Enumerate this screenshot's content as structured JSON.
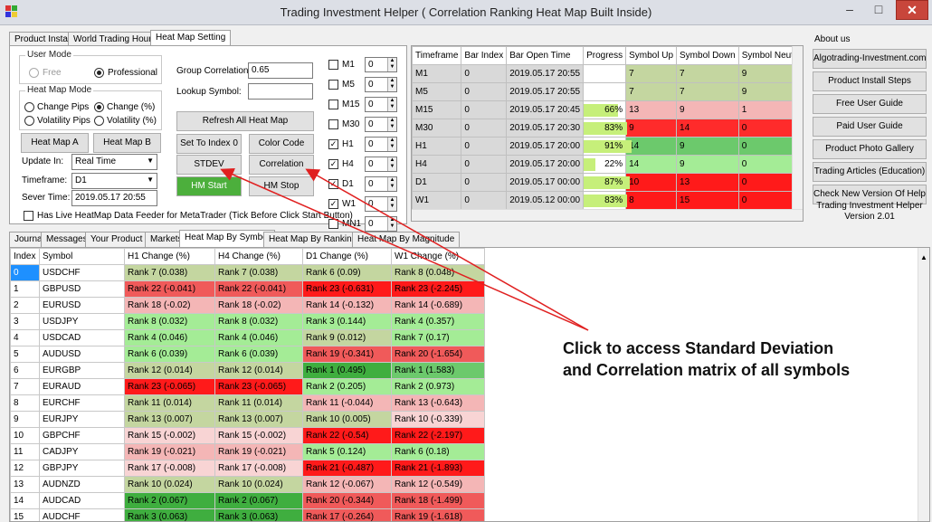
{
  "window": {
    "title": "Trading Investment Helper ( Correlation Ranking Heat Map Built Inside)",
    "minimize": "–",
    "maximize": "□",
    "close": "✕"
  },
  "top_tabs": [
    "Product Install",
    "World Trading Hours",
    "Heat Map Setting"
  ],
  "user_mode": {
    "title": "User Mode",
    "free": "Free",
    "professional": "Professional"
  },
  "heat_map_mode": {
    "title": "Heat Map Mode",
    "change_pips": "Change Pips",
    "change_pct": "Change (%)",
    "volatility_pips": "Volatility Pips",
    "volatility_pct": "Volatility (%)"
  },
  "buttons": {
    "heat_map_a": "Heat Map A",
    "heat_map_b": "Heat Map B",
    "refresh": "Refresh All Heat Map",
    "set_index": "Set To Index 0",
    "color_code": "Color Code",
    "stdev": "STDEV",
    "correlation": "Correlation",
    "hm_start": "HM Start",
    "hm_stop": "HM Stop"
  },
  "fields": {
    "update_in_label": "Update In:",
    "update_in_value": "Real Time",
    "timeframe_label": "Timeframe:",
    "timeframe_value": "D1",
    "server_time_label": "Sever Time:",
    "server_time_value": "2019.05.17 20:55",
    "group_corr_label": "Group Correlation:",
    "group_corr_value": "0.65",
    "lookup_label": "Lookup Symbol:",
    "lookup_value": ""
  },
  "live_feeder": "Has Live HeatMap Data Feeder for MetaTrader (Tick Before Click Start Button)",
  "tf_checks": [
    {
      "label": "M1",
      "value": "0",
      "checked": false
    },
    {
      "label": "M5",
      "value": "0",
      "checked": false
    },
    {
      "label": "M15",
      "value": "0",
      "checked": false
    },
    {
      "label": "M30",
      "value": "0",
      "checked": false
    },
    {
      "label": "H1",
      "value": "0",
      "checked": true
    },
    {
      "label": "H4",
      "value": "0",
      "checked": true
    },
    {
      "label": "D1",
      "value": "0",
      "checked": true
    },
    {
      "label": "W1",
      "value": "0",
      "checked": true
    },
    {
      "label": "MN1",
      "value": "0",
      "checked": false
    }
  ],
  "tf_table": {
    "headers": [
      "Timeframe",
      "Bar Index",
      "Bar Open Time",
      "Progress",
      "Symbol Up",
      "Symbol Down",
      "Symbol Neutral"
    ],
    "rows": [
      {
        "tf": "M1",
        "idx": "0",
        "time": "2019.05.17 20:55",
        "progress": "",
        "pct": 0,
        "up": "7",
        "down": "7",
        "neu": "9",
        "c": [
          "#c4d6a0",
          "#c4d6a0",
          "#c4d6a0"
        ]
      },
      {
        "tf": "M5",
        "idx": "0",
        "time": "2019.05.17 20:55",
        "progress": "",
        "pct": 0,
        "up": "7",
        "down": "7",
        "neu": "9",
        "c": [
          "#c4d6a0",
          "#c4d6a0",
          "#c4d6a0"
        ]
      },
      {
        "tf": "M15",
        "idx": "0",
        "time": "2019.05.17 20:45",
        "progress": "66%",
        "pct": 66,
        "up": "13",
        "down": "9",
        "neu": "1",
        "c": [
          "#f4b6b6",
          "#f4b6b6",
          "#f4b6b6"
        ]
      },
      {
        "tf": "M30",
        "idx": "0",
        "time": "2019.05.17 20:30",
        "progress": "83%",
        "pct": 83,
        "up": "9",
        "down": "14",
        "neu": "0",
        "c": [
          "#ff2b2b",
          "#ff2b2b",
          "#ff2b2b"
        ]
      },
      {
        "tf": "H1",
        "idx": "0",
        "time": "2019.05.17 20:00",
        "progress": "91%",
        "pct": 91,
        "up": "14",
        "down": "9",
        "neu": "0",
        "c": [
          "#6cc96c",
          "#6cc96c",
          "#6cc96c"
        ]
      },
      {
        "tf": "H4",
        "idx": "0",
        "time": "2019.05.17 20:00",
        "progress": "22%",
        "pct": 22,
        "up": "14",
        "down": "9",
        "neu": "0",
        "c": [
          "#a4ec96",
          "#a4ec96",
          "#a4ec96"
        ]
      },
      {
        "tf": "D1",
        "idx": "0",
        "time": "2019.05.17 00:00",
        "progress": "87%",
        "pct": 87,
        "up": "10",
        "down": "13",
        "neu": "0",
        "c": [
          "#ff1a1a",
          "#ff1a1a",
          "#ff1a1a"
        ]
      },
      {
        "tf": "W1",
        "idx": "0",
        "time": "2019.05.12 00:00",
        "progress": "83%",
        "pct": 83,
        "up": "8",
        "down": "15",
        "neu": "0",
        "c": [
          "#ff1a1a",
          "#ff1a1a",
          "#ff1a1a"
        ]
      }
    ]
  },
  "about": {
    "title": "About us",
    "links": [
      "Algotrading-Investment.com",
      "Product Install Steps",
      "Free User Guide",
      "Paid User Guide",
      "Product Photo Gallery",
      "Trading Articles (Education)",
      "Check New Version Of Helper"
    ],
    "version_line1": "Trading Investment Helper",
    "version_line2": "Version 2.01"
  },
  "bottom_tabs": [
    "Journal",
    "Messages",
    "Your Product",
    "Markets",
    "Heat Map By Symbol",
    "Heat Map By Ranking",
    "Heat Map By Magnitude"
  ],
  "sym_table": {
    "headers": [
      "Index",
      "Symbol",
      "H1 Change (%)",
      "H4 Change (%)",
      "D1 Change (%)",
      "W1 Change (%)"
    ],
    "rows": [
      {
        "i": "0",
        "s": "USDCHF",
        "h1": "Rank 7 (0.038)",
        "h4": "Rank 7 (0.038)",
        "d1": "Rank 6 (0.09)",
        "w1": "Rank 8 (0.048)",
        "c": [
          "#c4d6a0",
          "#c4d6a0",
          "#c4d6a0",
          "#c4d6a0"
        ]
      },
      {
        "i": "1",
        "s": "GBPUSD",
        "h1": "Rank 22 (-0.041)",
        "h4": "Rank 22 (-0.041)",
        "d1": "Rank 23 (-0.631)",
        "w1": "Rank 23 (-2.245)",
        "c": [
          "#f05a5a",
          "#f05a5a",
          "#ff1a1a",
          "#ff1a1a"
        ]
      },
      {
        "i": "2",
        "s": "EURUSD",
        "h1": "Rank 18 (-0.02)",
        "h4": "Rank 18 (-0.02)",
        "d1": "Rank 14 (-0.132)",
        "w1": "Rank 14 (-0.689)",
        "c": [
          "#f4b6b6",
          "#f4b6b6",
          "#f4b6b6",
          "#f4b6b6"
        ]
      },
      {
        "i": "3",
        "s": "USDJPY",
        "h1": "Rank 8 (0.032)",
        "h4": "Rank 8 (0.032)",
        "d1": "Rank 3 (0.144)",
        "w1": "Rank 4 (0.357)",
        "c": [
          "#a4ec96",
          "#a4ec96",
          "#a4ec96",
          "#a4ec96"
        ]
      },
      {
        "i": "4",
        "s": "USDCAD",
        "h1": "Rank 4 (0.046)",
        "h4": "Rank 4 (0.046)",
        "d1": "Rank 9 (0.012)",
        "w1": "Rank 7 (0.17)",
        "c": [
          "#a4ec96",
          "#a4ec96",
          "#c4d6a0",
          "#a4ec96"
        ]
      },
      {
        "i": "5",
        "s": "AUDUSD",
        "h1": "Rank 6 (0.039)",
        "h4": "Rank 6 (0.039)",
        "d1": "Rank 19 (-0.341)",
        "w1": "Rank 20 (-1.654)",
        "c": [
          "#a4ec96",
          "#a4ec96",
          "#f05a5a",
          "#f05a5a"
        ]
      },
      {
        "i": "6",
        "s": "EURGBP",
        "h1": "Rank 12 (0.014)",
        "h4": "Rank 12 (0.014)",
        "d1": "Rank 1 (0.495)",
        "w1": "Rank 1 (1.583)",
        "c": [
          "#c4d6a0",
          "#c4d6a0",
          "#3fae3f",
          "#6cc96c"
        ]
      },
      {
        "i": "7",
        "s": "EURAUD",
        "h1": "Rank 23 (-0.065)",
        "h4": "Rank 23 (-0.065)",
        "d1": "Rank 2 (0.205)",
        "w1": "Rank 2 (0.973)",
        "c": [
          "#ff1a1a",
          "#ff1a1a",
          "#a4ec96",
          "#a4ec96"
        ]
      },
      {
        "i": "8",
        "s": "EURCHF",
        "h1": "Rank 11 (0.014)",
        "h4": "Rank 11 (0.014)",
        "d1": "Rank 11 (-0.044)",
        "w1": "Rank 13 (-0.643)",
        "c": [
          "#c4d6a0",
          "#c4d6a0",
          "#f4b6b6",
          "#f4b6b6"
        ]
      },
      {
        "i": "9",
        "s": "EURJPY",
        "h1": "Rank 13 (0.007)",
        "h4": "Rank 13 (0.007)",
        "d1": "Rank 10 (0.005)",
        "w1": "Rank 10 (-0.339)",
        "c": [
          "#c4d6a0",
          "#c4d6a0",
          "#c4d6a0",
          "#f8d4d4"
        ]
      },
      {
        "i": "10",
        "s": "GBPCHF",
        "h1": "Rank 15 (-0.002)",
        "h4": "Rank 15 (-0.002)",
        "d1": "Rank 22 (-0.54)",
        "w1": "Rank 22 (-2.197)",
        "c": [
          "#f8d4d4",
          "#f8d4d4",
          "#ff1a1a",
          "#ff1a1a"
        ]
      },
      {
        "i": "11",
        "s": "CADJPY",
        "h1": "Rank 19 (-0.021)",
        "h4": "Rank 19 (-0.021)",
        "d1": "Rank 5 (0.124)",
        "w1": "Rank 6 (0.18)",
        "c": [
          "#f4b6b6",
          "#f4b6b6",
          "#a4ec96",
          "#a4ec96"
        ]
      },
      {
        "i": "12",
        "s": "GBPJPY",
        "h1": "Rank 17 (-0.008)",
        "h4": "Rank 17 (-0.008)",
        "d1": "Rank 21 (-0.487)",
        "w1": "Rank 21 (-1.893)",
        "c": [
          "#f8d4d4",
          "#f8d4d4",
          "#ff1a1a",
          "#ff1a1a"
        ]
      },
      {
        "i": "13",
        "s": "AUDNZD",
        "h1": "Rank 10 (0.024)",
        "h4": "Rank 10 (0.024)",
        "d1": "Rank 12 (-0.067)",
        "w1": "Rank 12 (-0.549)",
        "c": [
          "#c4d6a0",
          "#c4d6a0",
          "#f4b6b6",
          "#f4b6b6"
        ]
      },
      {
        "i": "14",
        "s": "AUDCAD",
        "h1": "Rank 2 (0.067)",
        "h4": "Rank 2 (0.067)",
        "d1": "Rank 20 (-0.344)",
        "w1": "Rank 18 (-1.499)",
        "c": [
          "#3fae3f",
          "#3fae3f",
          "#f05a5a",
          "#f05a5a"
        ]
      },
      {
        "i": "15",
        "s": "AUDCHF",
        "h1": "Rank 3 (0.063)",
        "h4": "Rank 3 (0.063)",
        "d1": "Rank 17 (-0.264)",
        "w1": "Rank 19 (-1.618)",
        "c": [
          "#3fae3f",
          "#3fae3f",
          "#f05a5a",
          "#f05a5a"
        ]
      }
    ]
  },
  "annotation": {
    "line1": "Click to access Standard Deviation",
    "line2": "and Correlation matrix of all symbols"
  },
  "colors": {
    "annotation_arrow": "#e02020",
    "hm_start": "#4caf3c",
    "selected_index": "#1e90ff"
  }
}
